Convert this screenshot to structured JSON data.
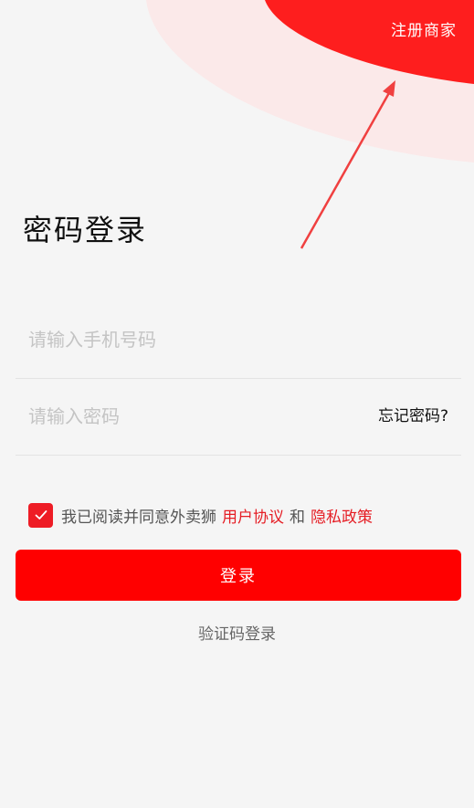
{
  "header": {
    "register_merchant_label": "注册商家"
  },
  "login": {
    "title": "密码登录",
    "phone_placeholder": "请输入手机号码",
    "password_placeholder": "请输入密码",
    "forgot_password_label": "忘记密码?"
  },
  "agreement": {
    "checked": true,
    "prefix_text": "我已阅读并同意外卖狮",
    "user_agreement_label": "用户协议",
    "and_text": "和",
    "privacy_policy_label": "隐私政策"
  },
  "actions": {
    "login_label": "登录",
    "sms_login_label": "验证码登录"
  },
  "colors": {
    "brand_red": "#ff0000",
    "link_red": "#e51d24",
    "background": "#f5f5f5",
    "deco_pink": "#fbeaea"
  }
}
